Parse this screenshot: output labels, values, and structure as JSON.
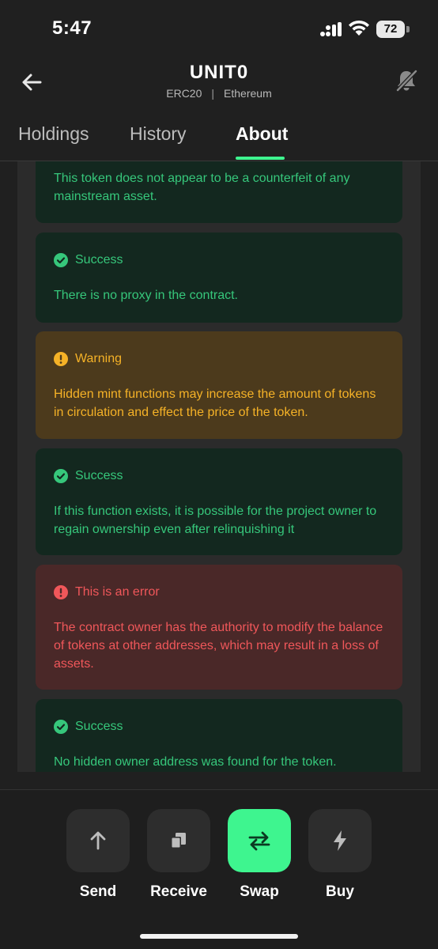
{
  "status": {
    "time": "5:47",
    "battery": "72"
  },
  "header": {
    "title": "UNIT0",
    "standard": "ERC20",
    "separator": "|",
    "network": "Ethereum"
  },
  "tabs": [
    {
      "label": "Holdings",
      "active": false
    },
    {
      "label": "History",
      "active": false
    },
    {
      "label": "About",
      "active": true
    }
  ],
  "checks": [
    {
      "type": "success",
      "title": "",
      "text": "This token does not appear to be a counterfeit of any mainstream asset."
    },
    {
      "type": "success",
      "title": "Success",
      "text": "There is no proxy in the contract."
    },
    {
      "type": "warning",
      "title": "Warning",
      "text": "Hidden mint functions may increase the amount of tokens in circulation and effect the price of the token."
    },
    {
      "type": "success",
      "title": "Success",
      "text": "If this function exists, it is possible for the project owner to regain ownership even after relinquishing it"
    },
    {
      "type": "error",
      "title": "This is an error",
      "text": "The contract owner has the authority to modify the balance of tokens at other addresses, which may result in a loss of assets."
    },
    {
      "type": "success",
      "title": "Success",
      "text": "No hidden owner address was found for the token."
    }
  ],
  "actions": [
    {
      "label": "Send",
      "icon": "arrow-up-icon"
    },
    {
      "label": "Receive",
      "icon": "copy-icon"
    },
    {
      "label": "Swap",
      "icon": "swap-icon"
    },
    {
      "label": "Buy",
      "icon": "lightning-icon"
    }
  ],
  "colors": {
    "accent": "#3ef58f",
    "success": "#36c77b",
    "warning": "#f5b227",
    "error": "#f0575a"
  }
}
